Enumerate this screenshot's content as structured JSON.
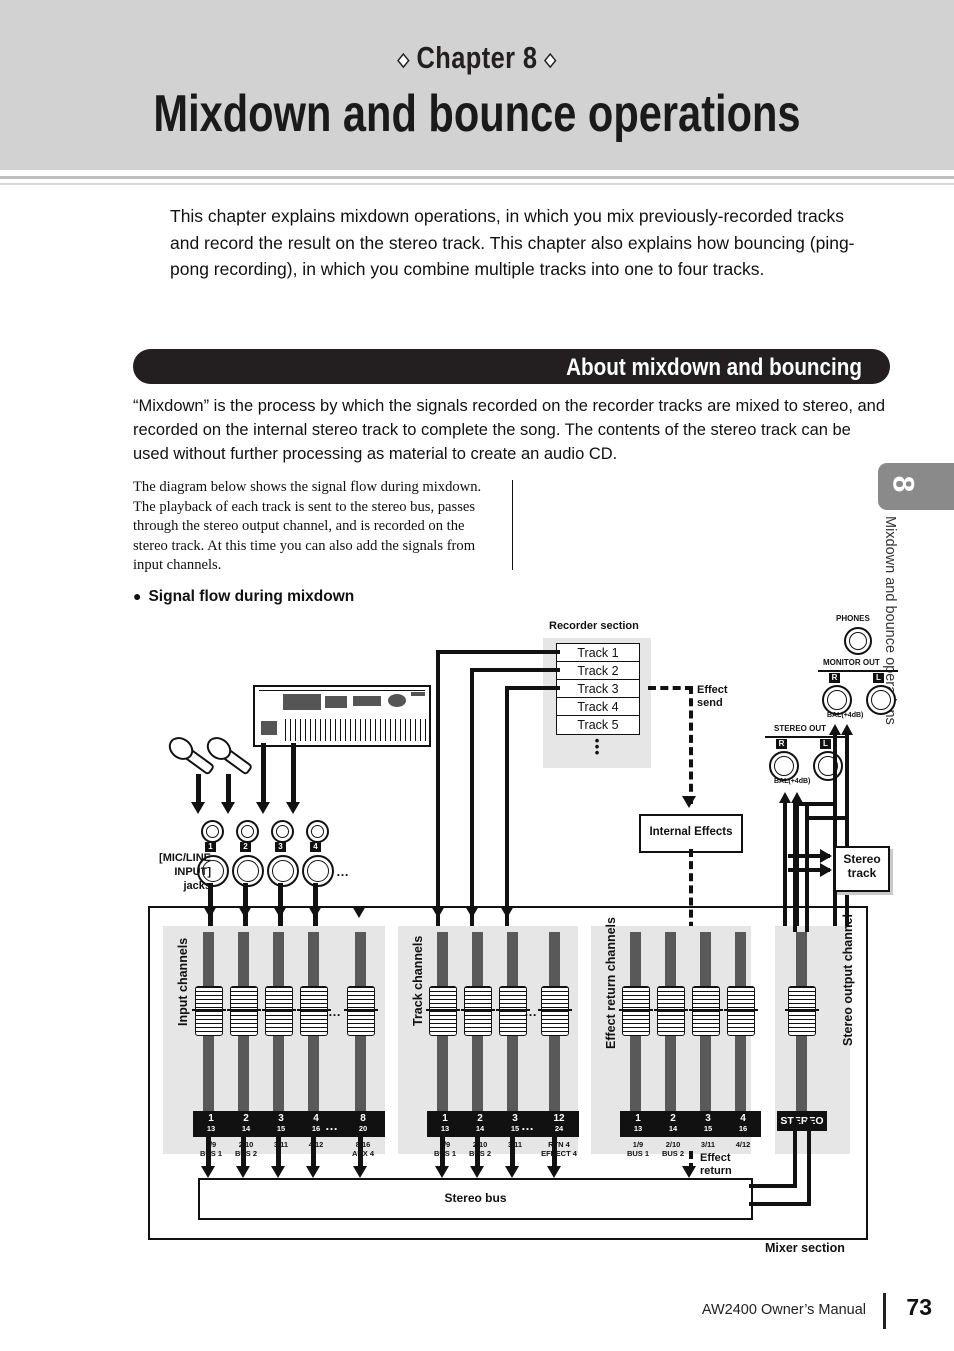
{
  "header": {
    "chapter_label": "Chapter 8",
    "diamond": "◆",
    "title": "Mixdown and bounce operations"
  },
  "intro_paragraph": "This chapter explains mixdown operations, in which you mix previously-recorded tracks and record the result on the stereo track. This chapter also explains how bouncing (ping-pong recording), in which you combine multiple tracks into one to four tracks.",
  "section_banner": "About mixdown and bouncing",
  "lead_paragraph": "“Mixdown” is the process by which the signals recorded on the recorder tracks are mixed to stereo, and recorded on the internal stereo track to complete the song. The contents of the stereo track can be used without further processing as material to create an audio CD.",
  "note_paragraph": "The diagram below shows the signal flow during mixdown. The playback of each track is sent to the stereo bus, passes through the stereo output channel, and is recorded on the stereo track. At this time you can also add the signals from input channels.",
  "subheading": "Signal flow during mixdown",
  "side_tab": {
    "number": "8",
    "text": "Mixdown and bounce operations"
  },
  "footer": {
    "manual": "AW2400  Owner’s Manual",
    "page": "73"
  },
  "diagram": {
    "recorder_section_label": "Recorder section",
    "tracks": [
      "Track 1",
      "Track 2",
      "Track 3",
      "Track 4",
      "Track 5"
    ],
    "track_continuation": "•\n•\n•",
    "effect_send_label": "Effect\nsend",
    "effect_send_line1": "Effect",
    "effect_send_line2": "send",
    "internal_effects_label": "Internal Effects",
    "stereo_track_label": "Stereo\ntrack",
    "stereo_track_line1": "Stereo",
    "stereo_track_line2": "track",
    "phones_label": "PHONES",
    "monitor_out_label": "MONITOR OUT",
    "monitor_out_r": "R",
    "monitor_out_l": "L",
    "monitor_out_bal": "BAL(+4dB)",
    "stereo_out_label": "STEREO OUT",
    "stereo_out_r": "R",
    "stereo_out_l": "L",
    "stereo_out_bal": "BAL(+4dB)",
    "mic_line_input_label": "[MIC/LINE\nINPUT]\njacks",
    "mic_line_l1": "[MIC/LINE",
    "mic_line_l2": "INPUT]",
    "mic_line_l3": "jacks",
    "input_jack_numbers": [
      "1",
      "2",
      "3",
      "4"
    ],
    "ellipsis": "…",
    "input_channels_label": "Input channels",
    "track_channels_label": "Track channels",
    "effect_return_channels_label": "Effect return channels",
    "stereo_output_channel_label": "Stereo output channel",
    "input_channel_strips": [
      {
        "top": "1",
        "bottom": "13",
        "u1": "1/9",
        "u2": "BUS 1"
      },
      {
        "top": "2",
        "bottom": "14",
        "u1": "2/10",
        "u2": "BUS 2"
      },
      {
        "top": "3",
        "bottom": "15",
        "u1": "3/11",
        "u2": ""
      },
      {
        "top": "4",
        "bottom": "16",
        "u1": "4/12",
        "u2": ""
      },
      {
        "top": "8",
        "bottom": "20",
        "u1": "8/16",
        "u2": "AUX 4"
      }
    ],
    "track_channel_strips": [
      {
        "top": "1",
        "bottom": "13",
        "u1": "1/9",
        "u2": "BUS 1"
      },
      {
        "top": "2",
        "bottom": "14",
        "u1": "2/10",
        "u2": "BUS 2"
      },
      {
        "top": "3",
        "bottom": "15",
        "u1": "3/11",
        "u2": ""
      },
      {
        "top": "12",
        "bottom": "24",
        "u1": "RTN 4",
        "u2": "EFEECT 4"
      }
    ],
    "effect_return_strips": [
      {
        "top": "1",
        "bottom": "13",
        "u1": "1/9",
        "u2": "BUS 1"
      },
      {
        "top": "2",
        "bottom": "14",
        "u1": "2/10",
        "u2": "BUS 2"
      },
      {
        "top": "3",
        "bottom": "15",
        "u1": "3/11",
        "u2": ""
      },
      {
        "top": "4",
        "bottom": "16",
        "u1": "4/12",
        "u2": ""
      }
    ],
    "stereo_strip_label": "STEREO",
    "stereo_bus_label": "Stereo bus",
    "effect_return_label": "Effect\nreturn",
    "effect_return_l1": "Effect",
    "effect_return_l2": "return",
    "mixer_section_label": "Mixer section"
  },
  "colors": {
    "header_band": "#d2d2d2",
    "banner": "#231f20",
    "panel": "#e6e6e6",
    "fader_track": "#595959",
    "tab": "#8a8a8a"
  }
}
